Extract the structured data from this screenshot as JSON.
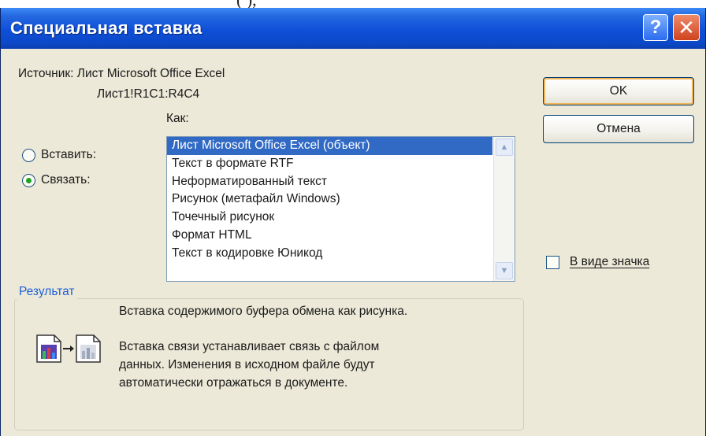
{
  "top_fragment": "(       ),",
  "dialog": {
    "title": "Специальная вставка",
    "help_symbol": "?",
    "close_symbol": "✕"
  },
  "source": {
    "label": "Источник: Лист Microsoft Office Excel",
    "range": "Лист1!R1C1:R4C4"
  },
  "as_label": "Как:",
  "radios": [
    {
      "label": "Вставить:",
      "checked": false
    },
    {
      "label": "Связать:",
      "checked": true
    }
  ],
  "formats": [
    {
      "label": "Лист Microsoft Office Excel (объект)",
      "selected": true
    },
    {
      "label": "Текст в формате RTF",
      "selected": false
    },
    {
      "label": "Неформатированный текст",
      "selected": false
    },
    {
      "label": "Рисунок (метафайл Windows)",
      "selected": false
    },
    {
      "label": "Точечный рисунок",
      "selected": false
    },
    {
      "label": "Формат HTML",
      "selected": false
    },
    {
      "label": "Текст в кодировке Юникод",
      "selected": false
    }
  ],
  "buttons": {
    "ok": "OK",
    "cancel": "Отмена"
  },
  "as_icon": {
    "label": "В виде значка",
    "checked": false
  },
  "result": {
    "title": "Результат",
    "line1": "Вставка содержимого буфера обмена как рисунка.",
    "line2": "Вставка связи устанавливает связь с файлом",
    "line3": "данных. Изменения в исходном файле будут",
    "line4": "автоматически отражаться в документе."
  },
  "colors": {
    "titlebar": "#0c49c9",
    "selection": "#316ac5",
    "group_title": "#1c5fd6",
    "dialog_bg": "#ece9d8"
  }
}
